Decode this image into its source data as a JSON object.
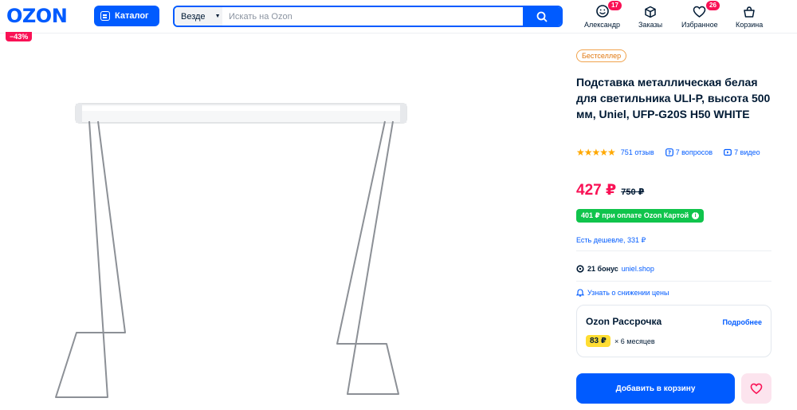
{
  "header": {
    "logo": "OZON",
    "catalog_label": "Каталог",
    "search_scope": "Везде",
    "search_placeholder": "Искать на Ozon",
    "nav": [
      {
        "label": "Александр",
        "icon": "profile-icon",
        "badge": "17"
      },
      {
        "label": "Заказы",
        "icon": "box-icon"
      },
      {
        "label": "Избранное",
        "icon": "heart-icon",
        "badge": "26"
      },
      {
        "label": "Корзина",
        "icon": "cart-icon"
      }
    ]
  },
  "product": {
    "discount": "−43%",
    "bestseller": "Бестселлер",
    "title": "Подставка металлическая белая для светильника ULI-P, высота 500 мм, Uniel, UFP-G20S H50 WHITE",
    "rating_stars": 5,
    "reviews": "751 отзыв",
    "questions": "7 вопросов",
    "videos": "7 видео",
    "price": "427 ₽",
    "old_price": "750 ₽",
    "card_price": "401 ₽ при оплате Ozon Картой",
    "cheaper": "Есть дешевле, 331 ₽",
    "bonus_amount": "21 бонус",
    "bonus_shop": "uniel.shop",
    "notify_label": "Узнать о снижении цены",
    "installment": {
      "title": "Ozon Рассрочка",
      "more": "Подробнее",
      "amount": "83 ₽",
      "months": "× 6 месяцев"
    },
    "add_to_cart": "Добавить в корзину"
  },
  "colors": {
    "brand_blue": "#005bff",
    "price_pink": "#f91155",
    "card_green": "#10c44c",
    "installment_yellow": "#ffdd33"
  }
}
